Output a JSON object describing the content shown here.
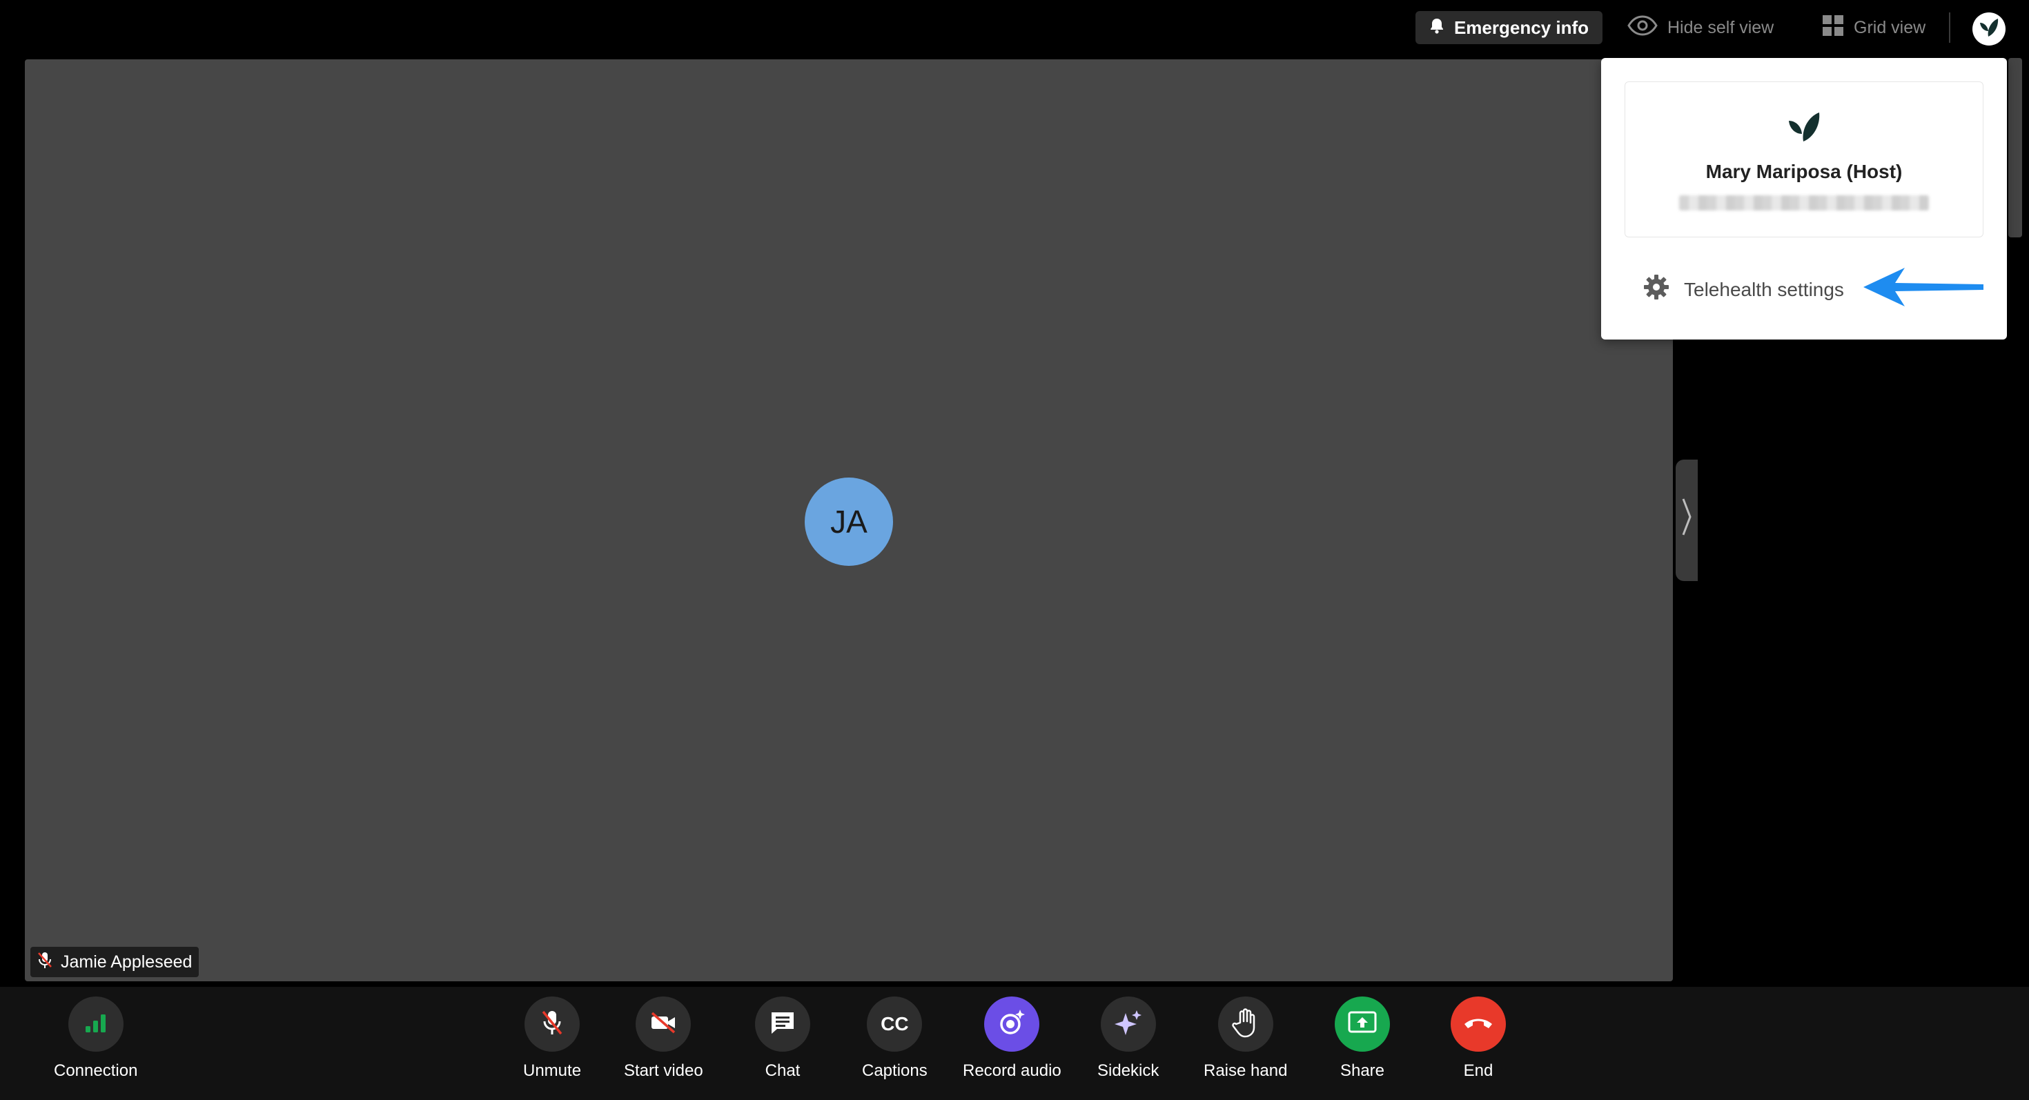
{
  "topbar": {
    "emergency_label": "Emergency info",
    "hide_self_label": "Hide self view",
    "grid_view_label": "Grid view"
  },
  "stage": {
    "initials": "JA",
    "participant_name": "Jamie Appleseed"
  },
  "dropdown": {
    "host_name": "Mary Mariposa (Host)",
    "settings_label": "Telehealth settings"
  },
  "toolbar": {
    "connection": "Connection",
    "unmute": "Unmute",
    "start_video": "Start video",
    "chat": "Chat",
    "captions": "Captions",
    "captions_glyph": "CC",
    "record_audio": "Record audio",
    "sidekick": "Sidekick",
    "raise_hand": "Raise hand",
    "share": "Share",
    "end": "End"
  },
  "colors": {
    "record_accent": "#6b4ee6",
    "share_green": "#17a84f",
    "end_red": "#e8392a",
    "avatar_blue": "#6aa5e0",
    "arrow_blue": "#1e8cf0",
    "brand_dark": "#14302e"
  }
}
